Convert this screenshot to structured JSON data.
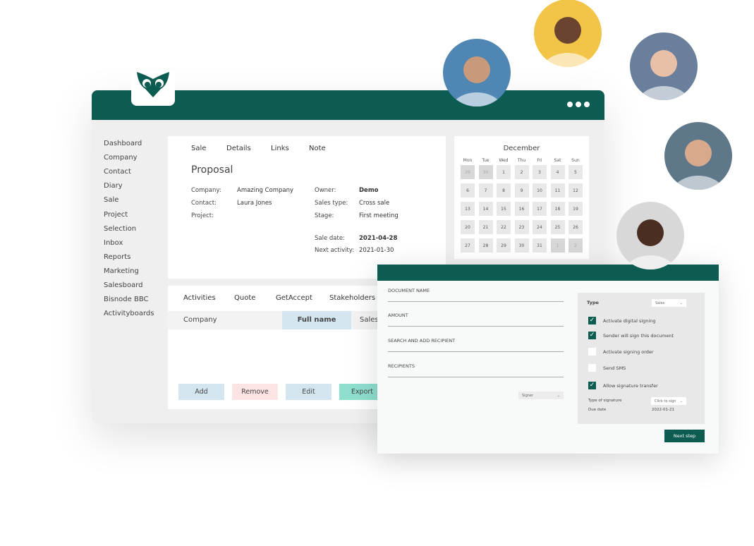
{
  "brand": {
    "color": "#0d5c52",
    "logo": "owl-logo"
  },
  "sidebar": {
    "items": [
      "Dashboard",
      "Company",
      "Contact",
      "Diary",
      "Sale",
      "Project",
      "Selection",
      "Inbox",
      "Reports",
      "Marketing",
      "Salesboard",
      "Bisnode BBC",
      "Activityboards"
    ]
  },
  "sale_card": {
    "tabs": [
      "Sale",
      "Details",
      "Links",
      "Note"
    ],
    "title": "Proposal",
    "left": [
      {
        "label": "Company:",
        "value": "Amazing Company"
      },
      {
        "label": "Contact:",
        "value": "Laura Jones"
      },
      {
        "label": "Project:",
        "value": ""
      }
    ],
    "right": [
      {
        "label": "Owner:",
        "value": "Demo"
      },
      {
        "label": "Sales type:",
        "value": "Cross sale"
      },
      {
        "label": "Stage:",
        "value": "First meeting"
      }
    ],
    "sale_date_label": "Sale date:",
    "sale_date": "2021-04-28",
    "next_activity_label": "Next activity:",
    "next_activity": "2021-01-30"
  },
  "calendar": {
    "month": "December",
    "days": [
      "Mon",
      "Tue",
      "Wed",
      "Thu",
      "Fri",
      "Sat",
      "Sun"
    ],
    "cells": [
      "29",
      "30",
      "1",
      "2",
      "3",
      "4",
      "5",
      "6",
      "7",
      "8",
      "9",
      "10",
      "11",
      "12",
      "13",
      "14",
      "15",
      "16",
      "17",
      "18",
      "19",
      "20",
      "21",
      "22",
      "23",
      "24",
      "25",
      "26",
      "27",
      "28",
      "29",
      "30",
      "31",
      "1",
      "2"
    ]
  },
  "activities_card": {
    "tabs": [
      "Activities",
      "Quote",
      "GetAccept",
      "Stakeholders"
    ],
    "columns": [
      "Company",
      "Full name",
      "Sales"
    ],
    "buttons": [
      {
        "label": "Add",
        "color": "#d3e6f0"
      },
      {
        "label": "Remove",
        "color": "#fde3e3"
      },
      {
        "label": "Edit",
        "color": "#d3e6f0"
      },
      {
        "label": "Export",
        "color": "#8fdfcf"
      }
    ]
  },
  "dialog": {
    "fields": [
      "DOCUMENT NAME",
      "AMOUNT",
      "SEARCH AND ADD RECIPIENT",
      "RECIPIENTS"
    ],
    "signer_select": "Signer",
    "type_label": "Type",
    "type_value": "Sales",
    "options": [
      {
        "label": "Activate digital signing",
        "checked": true
      },
      {
        "label": "Sender will sign this document",
        "checked": true
      },
      {
        "label": "Activate signing order",
        "checked": false
      },
      {
        "label": "Send SMS",
        "checked": false
      },
      {
        "label": "Allow signature transfer",
        "checked": true
      }
    ],
    "signature_type_label": "Type of signature",
    "signature_type_value": "Click to sign",
    "due_date_label": "Due date",
    "due_date": "2022-01-21",
    "next_button": "Next step"
  }
}
